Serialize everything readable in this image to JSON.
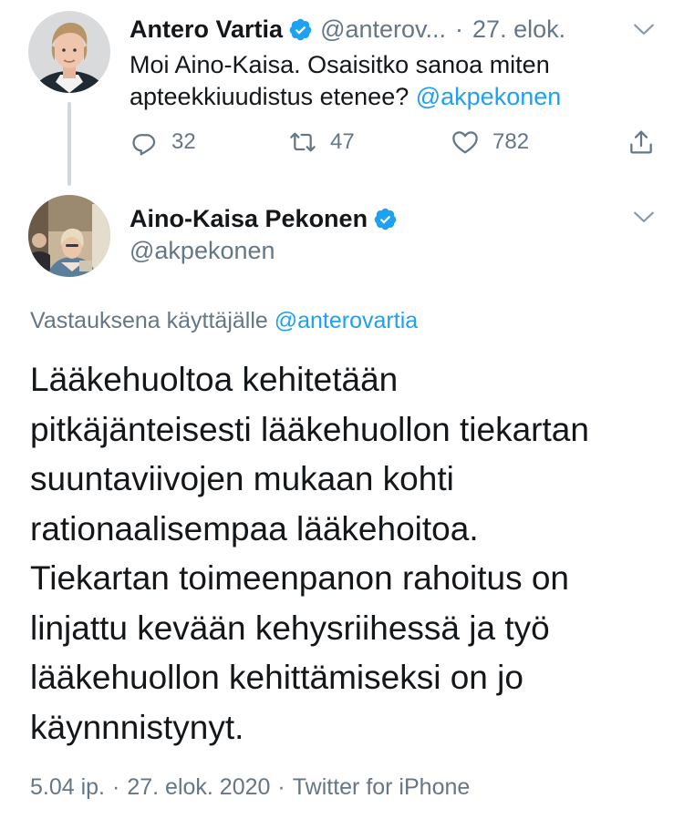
{
  "parent_tweet": {
    "name": "Antero Vartia",
    "handle": "@anterov...",
    "separator": "·",
    "date": "27. elok.",
    "text_before_mention": "Moi Aino-Kaisa. Osaisitko sanoa miten apteekkiuudistus etenee? ",
    "mention": "@akpekonen",
    "reply_count": "32",
    "retweet_count": "47",
    "like_count": "782"
  },
  "focused_tweet": {
    "name": "Aino-Kaisa Pekonen",
    "handle": "@akpekonen",
    "reply_to_prefix": "Vastauksena käyttäjälle ",
    "reply_to_handle": "@anterovartia",
    "body_lines": [
      "Lääkehuoltoa kehitetään",
      "pitkäjänteisesti lääkehuollon tiekartan",
      "suuntaviivojen mukaan kohti",
      "rationaalisempaa lääkehoitoa.",
      "Tiekartan toimeenpanon rahoitus on",
      "linjattu kevään kehysriihessä ja työ",
      "lääkehuollon kehittämiseksi on jo",
      "käynnnistynyt."
    ],
    "time": "5.04 ip.",
    "date": "27. elok. 2020",
    "source": "Twitter for iPhone",
    "meta_separator": "·"
  },
  "icons": {
    "verified": "verified-badge-icon",
    "reply": "reply-icon",
    "retweet": "retweet-icon",
    "like": "heart-icon",
    "share": "share-icon",
    "menu": "chevron-down-icon"
  },
  "colors": {
    "accent": "#1da1f2",
    "text": "#14171a",
    "secondary": "#657786",
    "thread_line": "#cfd9de"
  }
}
